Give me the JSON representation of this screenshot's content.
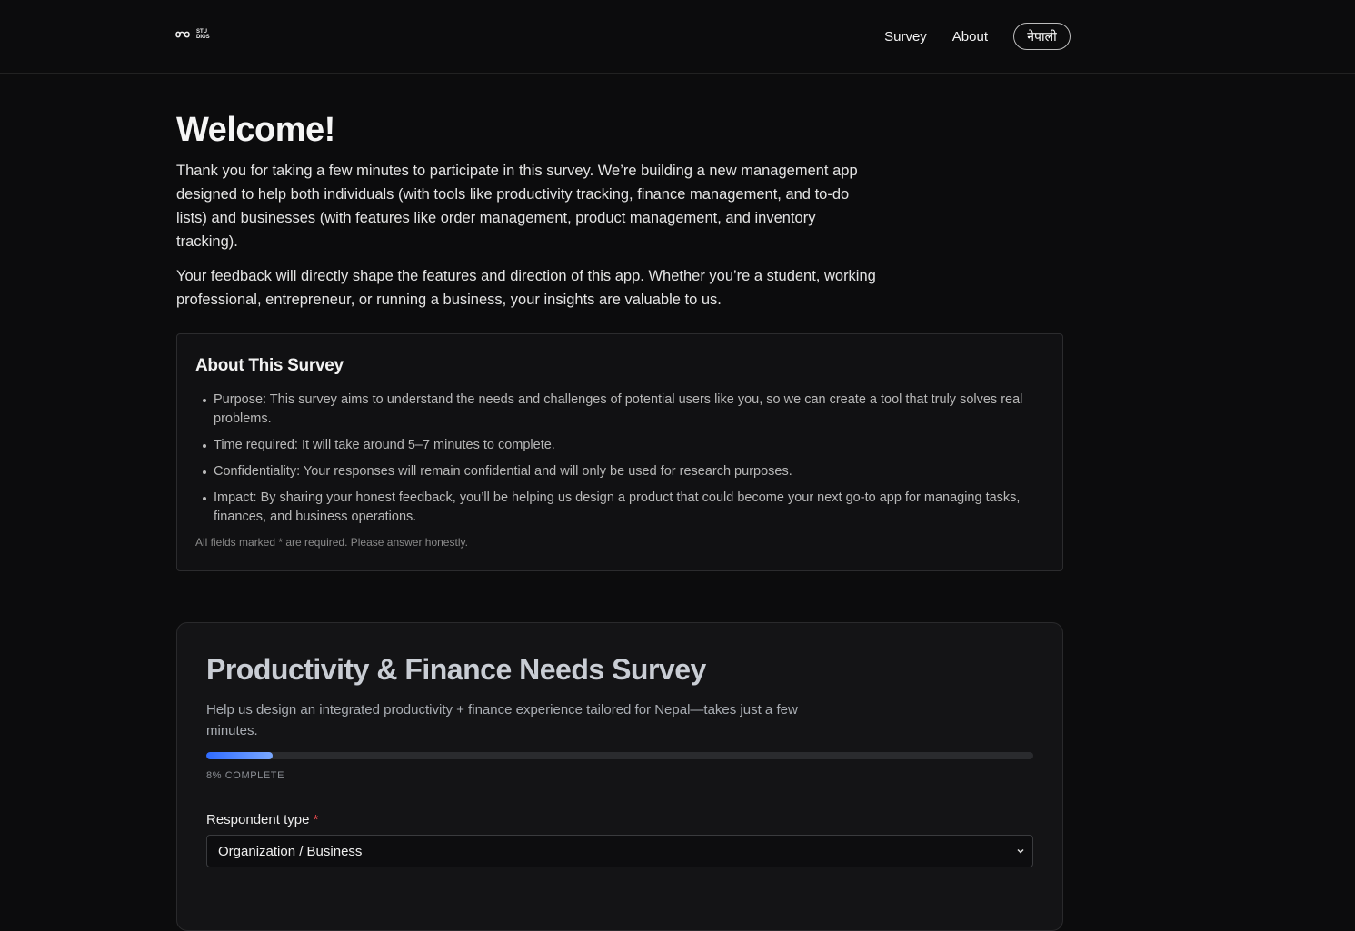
{
  "header": {
    "logo_text_top": "STU",
    "logo_text_bottom": "DIOS",
    "nav": [
      {
        "label": "Survey"
      },
      {
        "label": "About"
      }
    ],
    "language_button": "नेपाली"
  },
  "welcome": {
    "title": "Welcome!",
    "paragraphs": [
      "Thank you for taking a few minutes to participate in this survey. We’re building a new management app designed to help both individuals (with tools like productivity tracking, finance management, and to-do lists) and businesses (with features like order management, product management, and inventory tracking).",
      "Your feedback will directly shape the features and direction of this app. Whether you’re a student, working professional, entrepreneur, or running a business, your insights are valuable to us."
    ]
  },
  "about": {
    "title": "About This Survey",
    "items": [
      "Purpose: This survey aims to understand the needs and challenges of potential users like you, so we can create a tool that truly solves real problems.",
      "Time required: It will take around 5–7 minutes to complete.",
      "Confidentiality: Your responses will remain confidential and will only be used for research purposes.",
      "Impact: By sharing your honest feedback, you’ll be helping us design a product that could become your next go-to app for managing tasks, finances, and business operations."
    ],
    "note": "All fields marked * are required. Please answer honestly."
  },
  "survey": {
    "title": "Productivity & Finance Needs Survey",
    "subtitle": "Help us design an integrated productivity + finance experience tailored for Nepal—takes just a few minutes.",
    "progress_fraction": 0.08,
    "progress_label": "8% COMPLETE",
    "accent_colors": [
      "#2f6bff",
      "#7aa8ff"
    ],
    "respondent_type": {
      "label": "Respondent type",
      "required_mark": "*",
      "selected": "Organization / Business"
    }
  },
  "icons": {
    "logo": "infinity-logo-icon",
    "select_arrow": "chevron-down-icon"
  }
}
